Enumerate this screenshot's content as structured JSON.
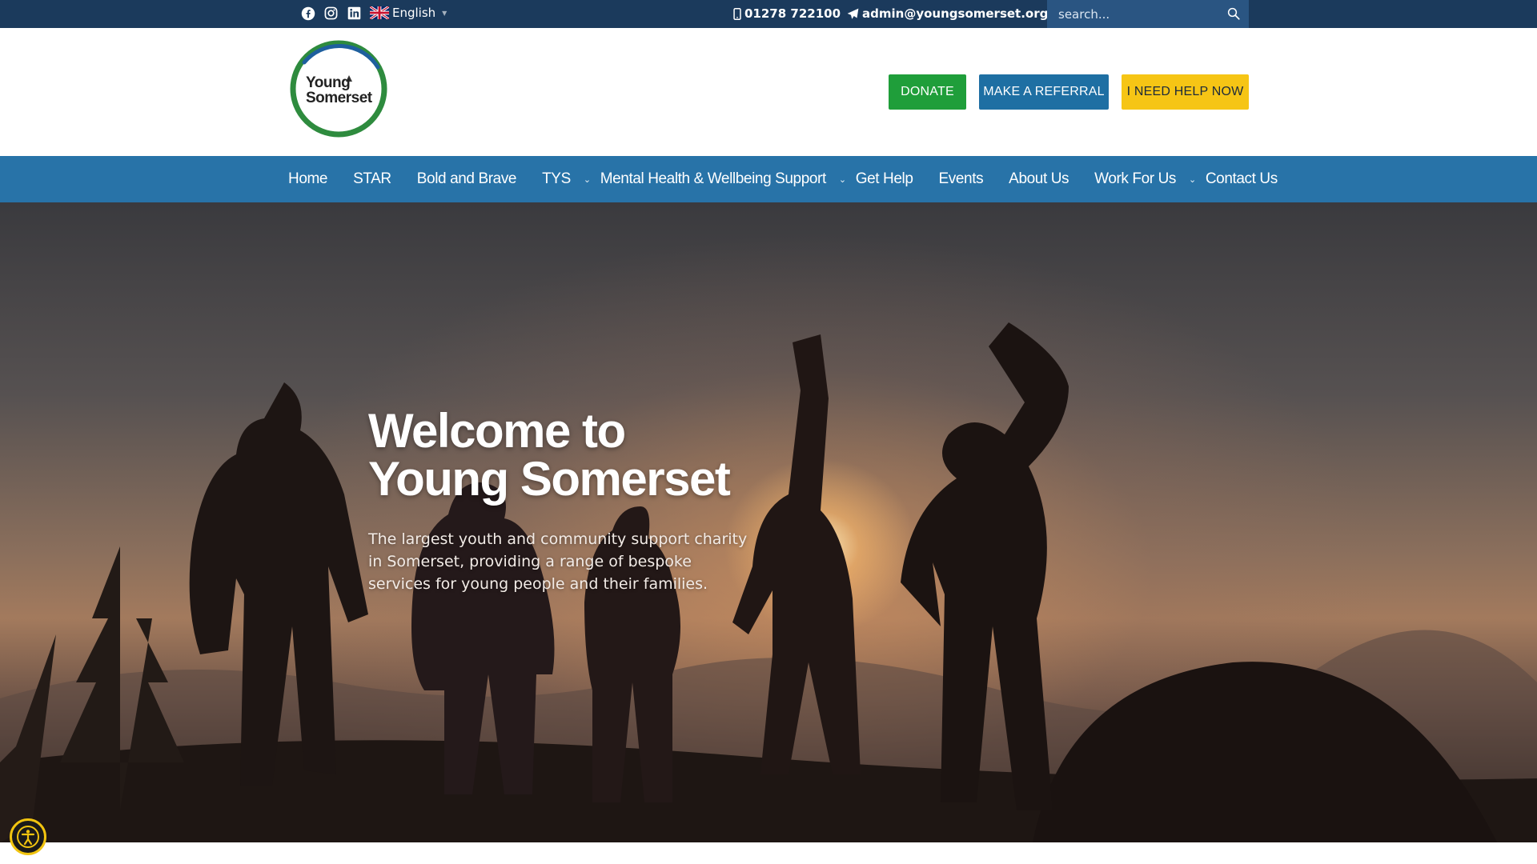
{
  "topbar": {
    "social_icons": [
      "facebook-icon",
      "instagram-icon",
      "linkedin-icon"
    ],
    "language": "English",
    "phone": "01278 722100",
    "email": "admin@youngsomerset.org.uk",
    "search_placeholder": "search..."
  },
  "header": {
    "logo_line1": "Young",
    "logo_line2": "Somerset",
    "buttons": {
      "donate": "DONATE",
      "referral": "MAKE A REFERRAL",
      "help": "I NEED HELP NOW"
    }
  },
  "nav": {
    "items": [
      {
        "label": "Home"
      },
      {
        "label": "STAR"
      },
      {
        "label": "Bold and Brave"
      },
      {
        "label": "TYS"
      },
      {
        "label": "Mental Health & Wellbeing Support"
      },
      {
        "label": "Get Help"
      },
      {
        "label": "Events"
      },
      {
        "label": "About Us"
      },
      {
        "label": "Work For Us"
      },
      {
        "label": "Contact Us"
      }
    ]
  },
  "hero": {
    "title_line1": "Welcome to",
    "title_line2": "Young Somerset",
    "subtitle": "The largest youth and community support charity in Somerset, providing a range of bespoke services for young people and their families."
  },
  "colors": {
    "topbar": "#1b3a5c",
    "nav": "#2873a8",
    "donate": "#1f9e3a",
    "referral": "#1e6fa3",
    "help": "#f6c515"
  }
}
